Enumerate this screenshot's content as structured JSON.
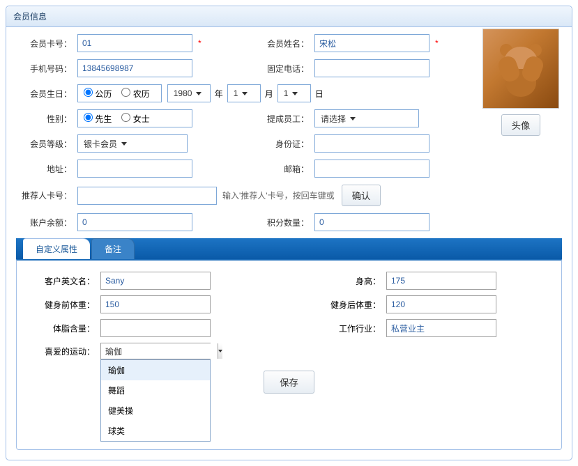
{
  "panel": {
    "title": "会员信息"
  },
  "labels": {
    "card_no": "会员卡号：",
    "name": "会员姓名：",
    "mobile": "手机号码：",
    "tel": "固定电话：",
    "birthday": "会员生日：",
    "year_unit": "年",
    "month_unit": "月",
    "day_unit": "日",
    "gender": "性别：",
    "staff": "提成员工：",
    "level": "会员等级：",
    "idcard": "身份证：",
    "address": "地址：",
    "email": "邮箱：",
    "referrer": "推荐人卡号：",
    "referrer_hint": "输入'推荐人'卡号，按回车键或",
    "confirm": "确认",
    "balance": "账户余额：",
    "points": "积分数量：",
    "avatar_btn": "头像"
  },
  "values": {
    "card_no": "01",
    "name": "宋松",
    "mobile": "13845698987",
    "tel": "",
    "calendar_solar": "公历",
    "calendar_lunar": "农历",
    "year": "1980",
    "month": "1",
    "day": "1",
    "gender_male": "先生",
    "gender_female": "女士",
    "staff": "请选择",
    "level": "银卡会员",
    "idcard": "",
    "address": "",
    "email": "",
    "referrer": "",
    "balance": "0",
    "points": "0"
  },
  "tabs": {
    "custom": "自定义属性",
    "remark": "备注"
  },
  "custom": {
    "labels": {
      "en_name": "客户英文名：",
      "height": "身高：",
      "weight_before": "健身前体重：",
      "weight_after": "健身后体重：",
      "body_fat": "体脂含量：",
      "industry": "工作行业：",
      "favorite_sport": "喜爱的运动：",
      "save": "保存"
    },
    "values": {
      "en_name": "Sany",
      "height": "175",
      "weight_before": "150",
      "weight_after": "120",
      "body_fat": "",
      "industry": "私营业主",
      "favorite_sport": "瑜伽"
    },
    "sport_options": [
      "瑜伽",
      "舞蹈",
      "健美操",
      "球类"
    ]
  }
}
